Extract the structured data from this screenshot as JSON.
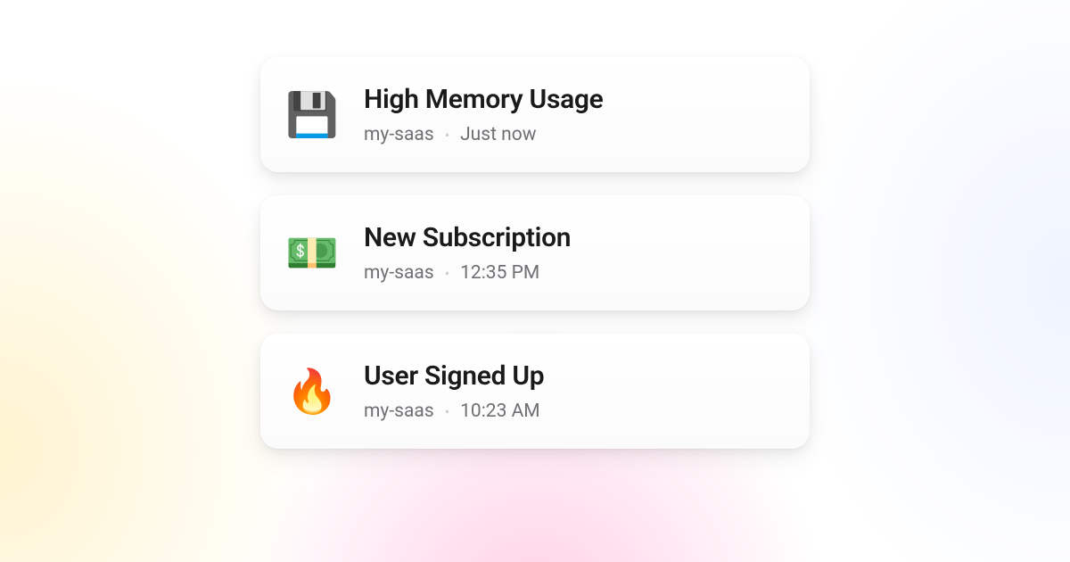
{
  "notifications": [
    {
      "icon": "💾",
      "icon_name": "floppy-disk-icon",
      "title": "High Memory Usage",
      "project": "my-saas",
      "time": "Just now"
    },
    {
      "icon": "💵",
      "icon_name": "money-icon",
      "title": "New Subscription",
      "project": "my-saas",
      "time": "12:35 PM"
    },
    {
      "icon": "🔥",
      "icon_name": "fire-icon",
      "title": "User Signed Up",
      "project": "my-saas",
      "time": "10:23 AM"
    }
  ],
  "separator": "•"
}
